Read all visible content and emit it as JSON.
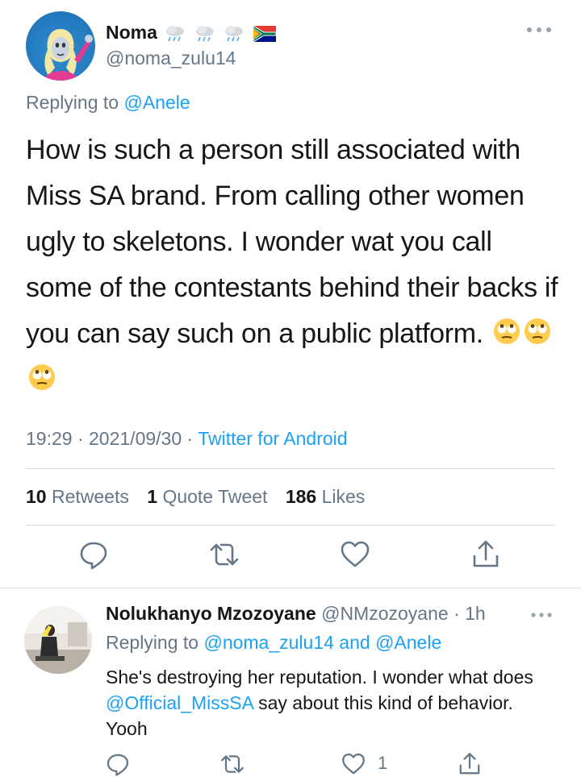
{
  "main_tweet": {
    "author_name": "Noma",
    "author_handle": "@noma_zulu14",
    "replying_label": "Replying to",
    "replying_to": "@Anele",
    "text": "How is such a person still associated with Miss SA brand. From calling other women ugly to skeletons. I wonder wat you call some of the contestants behind their backs if you can say such on a public platform.",
    "time": "19:29",
    "date": "2021/09/30",
    "separator": "·",
    "source": "Twitter for Android",
    "stats": {
      "retweets_count": "10",
      "retweets_label": "Retweets",
      "quotes_count": "1",
      "quotes_label": "Quote Tweet",
      "likes_count": "186",
      "likes_label": "Likes"
    }
  },
  "reply": {
    "author_name": "Nolukhanyo Mzozoyane",
    "author_handle": "@NMzozoyane",
    "age": "· 1h",
    "replying_label": "Replying to",
    "replying_to": "@noma_zulu14 and @Anele",
    "text_before": "She's destroying her reputation. I wonder what does ",
    "mention": "@Official_MissSA",
    "text_after": " say about this kind of behavior. Yooh",
    "like_count": "1"
  },
  "icons": {
    "more": "more-horizontal-icon",
    "reply": "reply-icon",
    "retweet": "retweet-icon",
    "like": "heart-icon",
    "share": "share-icon"
  },
  "colors": {
    "accent": "#1da1f2",
    "secondary_text": "#657786",
    "primary_text": "#14171a",
    "divider": "#d8dde1"
  }
}
